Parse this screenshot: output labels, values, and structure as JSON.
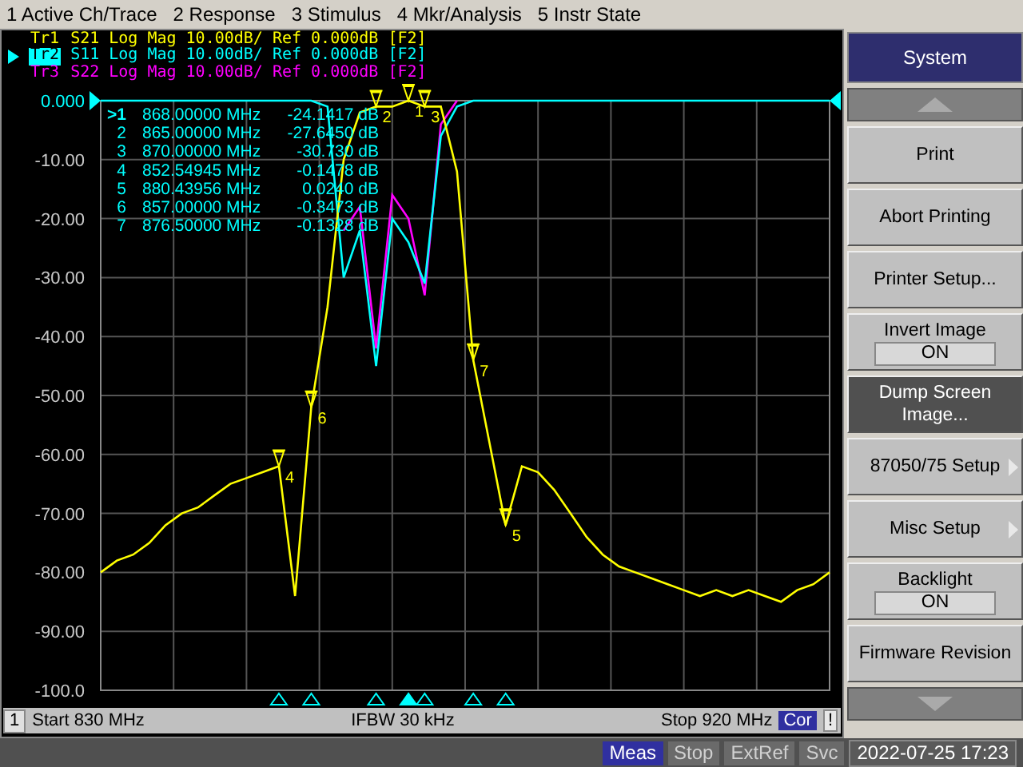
{
  "menu_bar": [
    "1 Active Ch/Trace",
    "2 Response",
    "3 Stimulus",
    "4 Mkr/Analysis",
    "5 Instr State"
  ],
  "traces": [
    {
      "label": "Tr1",
      "parameter": "S21",
      "format": "Log Mag",
      "scale": "10.00dB/",
      "reference": "Ref 0.000dB",
      "marker": "[F2]",
      "color": "#ffff00",
      "selected": false
    },
    {
      "label": "Tr2",
      "parameter": "S11",
      "format": "Log Mag",
      "scale": "10.00dB/",
      "reference": "Ref 0.000dB",
      "marker": "[F2]",
      "color": "#00ffff",
      "selected": true
    },
    {
      "label": "Tr3",
      "parameter": "S22",
      "format": "Log Mag",
      "scale": "10.00dB/",
      "reference": "Ref 0.000dB",
      "marker": "[F2]",
      "color": "#ff00ff",
      "selected": false
    }
  ],
  "marker_table": [
    {
      "number": ">1",
      "stimulus": "868.00000 MHz",
      "response": "-24.1417 dB",
      "selected": true
    },
    {
      "number": "2",
      "stimulus": "865.00000 MHz",
      "response": "-27.6450 dB",
      "selected": false
    },
    {
      "number": "3",
      "stimulus": "870.00000 MHz",
      "response": "-30.730 dB",
      "selected": false
    },
    {
      "number": "4",
      "stimulus": "852.54945 MHz",
      "response": "-0.1478 dB",
      "selected": false
    },
    {
      "number": "5",
      "stimulus": "880.43956 MHz",
      "response": "0.0240 dB",
      "selected": false
    },
    {
      "number": "6",
      "stimulus": "857.00000 MHz",
      "response": "-0.3473 dB",
      "selected": false
    },
    {
      "number": "7",
      "stimulus": "876.50000 MHz",
      "response": "-0.1328 dB",
      "selected": false
    }
  ],
  "chart_data": {
    "type": "line",
    "ylim": [
      -100,
      0
    ],
    "grid": true,
    "yticks": [
      {
        "value": 0,
        "label": "0.000"
      },
      {
        "value": -10,
        "label": "-10.00"
      },
      {
        "value": -20,
        "label": "-20.00"
      },
      {
        "value": -30,
        "label": "-30.00"
      },
      {
        "value": -40,
        "label": "-40.00"
      },
      {
        "value": -50,
        "label": "-50.00"
      },
      {
        "value": -60,
        "label": "-60.00"
      },
      {
        "value": -70,
        "label": "-70.00"
      },
      {
        "value": -80,
        "label": "-80.00"
      },
      {
        "value": -90,
        "label": "-90.00"
      },
      {
        "value": -100,
        "label": "-100.0"
      }
    ],
    "categories": [
      null,
      null,
      null,
      null,
      null,
      null,
      null,
      null,
      null,
      null,
      null,
      null,
      null,
      null,
      null,
      null,
      null,
      null,
      null,
      null,
      null,
      null,
      null,
      null,
      null,
      null,
      null,
      null,
      null,
      null,
      null,
      null,
      null,
      null,
      null,
      null,
      null,
      null,
      null,
      null,
      null,
      null,
      null,
      null,
      null,
      null
    ],
    "series": [
      {
        "color": "#ffff00",
        "values": [
          -80,
          -78,
          -77,
          -75,
          -72,
          -70,
          -69,
          -67,
          -65,
          -64,
          -63,
          -62,
          -84,
          -52,
          -35,
          -10,
          -2,
          -1,
          -1,
          0,
          -1,
          -1,
          -12,
          -44,
          -58,
          -72,
          -62,
          -63,
          -66,
          -70,
          -74,
          -77,
          -79,
          -80,
          -81,
          -82,
          -83,
          -84,
          -83,
          -84,
          -83,
          -84,
          -85,
          -83,
          -82,
          -80
        ]
      },
      {
        "color": "#00ffff",
        "values": [
          0,
          0,
          0,
          0,
          0,
          0,
          0,
          0,
          0,
          0,
          0,
          0,
          0,
          0,
          -1,
          -30,
          -22,
          -45,
          -20,
          -24,
          -31,
          -6,
          -1,
          0,
          0,
          0,
          0,
          0,
          0,
          0,
          0,
          0,
          0,
          0,
          0,
          0,
          0,
          0,
          0,
          0,
          0,
          0,
          0,
          0,
          0,
          0
        ]
      },
      {
        "color": "#ff00ff",
        "values": [
          null,
          null,
          null,
          null,
          null,
          null,
          null,
          null,
          null,
          null,
          null,
          null,
          null,
          null,
          null,
          -22,
          -18,
          -42,
          -16,
          -20,
          -33,
          -4,
          0,
          null,
          null,
          null,
          null,
          null,
          null,
          null,
          null,
          null,
          null,
          null,
          null,
          null,
          null,
          null,
          null,
          null,
          null,
          null,
          null,
          null,
          null,
          null
        ]
      }
    ]
  },
  "trace_markers": [
    {
      "label": "1"
    },
    {
      "label": "2"
    },
    {
      "label": "3"
    },
    {
      "label": "4"
    },
    {
      "label": "5"
    },
    {
      "label": "6"
    },
    {
      "label": "7"
    }
  ],
  "channel_bar": {
    "channel": "1",
    "start": "Start 830 MHz",
    "ifbw": "IFBW 30 kHz",
    "stop": "Stop 920 MHz",
    "correction": "Cor",
    "warning": "!"
  },
  "softkeys": {
    "title": "System",
    "items": [
      {
        "kind": "button",
        "label": "Print",
        "selected": false
      },
      {
        "kind": "button",
        "label": "Abort Printing",
        "selected": false
      },
      {
        "kind": "button",
        "label": "Printer Setup...",
        "selected": false
      },
      {
        "kind": "toggle",
        "label": "Invert Image",
        "value": "ON",
        "selected": false
      },
      {
        "kind": "button",
        "label": "Dump Screen Image...",
        "selected": true
      },
      {
        "kind": "submenu",
        "label": "87050/75 Setup",
        "selected": false
      },
      {
        "kind": "submenu",
        "label": "Misc Setup",
        "selected": false
      },
      {
        "kind": "toggle",
        "label": "Backlight",
        "value": "ON",
        "selected": false
      },
      {
        "kind": "button",
        "label": "Firmware Revision",
        "selected": false
      }
    ]
  },
  "status_bar": [
    {
      "label": "Meas",
      "on": true
    },
    {
      "label": "Stop",
      "on": false
    },
    {
      "label": "ExtRef",
      "on": false
    },
    {
      "label": "Svc",
      "on": false
    }
  ],
  "datetime": "2022-07-25 17:23"
}
